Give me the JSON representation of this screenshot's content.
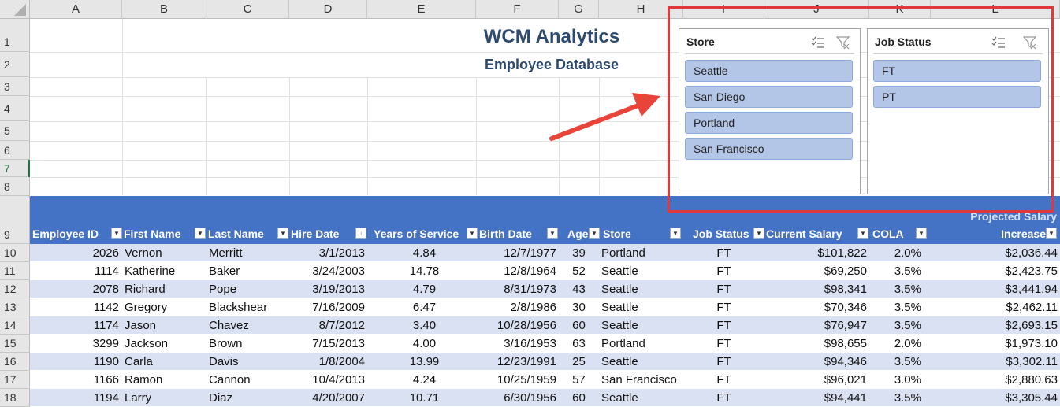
{
  "columns": [
    "A",
    "B",
    "C",
    "D",
    "E",
    "F",
    "G",
    "H",
    "I",
    "J",
    "K",
    "L"
  ],
  "row_numbers": [
    "1",
    "2",
    "3",
    "4",
    "5",
    "6",
    "7",
    "8",
    "9",
    "10",
    "11",
    "12",
    "13",
    "14",
    "15",
    "16",
    "17",
    "18"
  ],
  "title": "WCM Analytics",
  "subtitle": "Employee Database",
  "headers": {
    "employee_id": "Employee ID",
    "first_name": "First Name",
    "last_name": "Last Name",
    "hire_date": "Hire Date",
    "years_service": "Years of Service",
    "birth_date": "Birth Date",
    "age": "Age",
    "store": "Store",
    "job_status": "Job Status",
    "current_salary": "Current Salary",
    "cola": "COLA",
    "projected_line1": "Projected Salary",
    "projected_line2": "Increase"
  },
  "rows": [
    {
      "id": "2026",
      "first": "Vernon",
      "last": "Merritt",
      "hire": "3/1/2013",
      "years": "4.84",
      "birth": "12/7/1977",
      "age": "39",
      "store": "Portland",
      "status": "FT",
      "salary": "$101,822",
      "cola": "2.0%",
      "projected": "$2,036.44"
    },
    {
      "id": "1114",
      "first": "Katherine",
      "last": "Baker",
      "hire": "3/24/2003",
      "years": "14.78",
      "birth": "12/8/1964",
      "age": "52",
      "store": "Seattle",
      "status": "FT",
      "salary": "$69,250",
      "cola": "3.5%",
      "projected": "$2,423.75"
    },
    {
      "id": "2078",
      "first": "Richard",
      "last": "Pope",
      "hire": "3/19/2013",
      "years": "4.79",
      "birth": "8/31/1973",
      "age": "43",
      "store": "Seattle",
      "status": "FT",
      "salary": "$98,341",
      "cola": "3.5%",
      "projected": "$3,441.94"
    },
    {
      "id": "1142",
      "first": "Gregory",
      "last": "Blackshear",
      "hire": "7/16/2009",
      "years": "6.47",
      "birth": "2/8/1986",
      "age": "30",
      "store": "Seattle",
      "status": "FT",
      "salary": "$70,346",
      "cola": "3.5%",
      "projected": "$2,462.11"
    },
    {
      "id": "1174",
      "first": "Jason",
      "last": "Chavez",
      "hire": "8/7/2012",
      "years": "3.40",
      "birth": "10/28/1956",
      "age": "60",
      "store": "Seattle",
      "status": "FT",
      "salary": "$76,947",
      "cola": "3.5%",
      "projected": "$2,693.15"
    },
    {
      "id": "3299",
      "first": "Jackson",
      "last": "Brown",
      "hire": "7/15/2013",
      "years": "4.00",
      "birth": "3/16/1953",
      "age": "63",
      "store": "Portland",
      "status": "FT",
      "salary": "$98,655",
      "cola": "2.0%",
      "projected": "$1,973.10"
    },
    {
      "id": "1190",
      "first": "Carla",
      "last": "Davis",
      "hire": "1/8/2004",
      "years": "13.99",
      "birth": "12/23/1991",
      "age": "25",
      "store": "Seattle",
      "status": "FT",
      "salary": "$94,346",
      "cola": "3.5%",
      "projected": "$3,302.11"
    },
    {
      "id": "1166",
      "first": "Ramon",
      "last": "Cannon",
      "hire": "10/4/2013",
      "years": "4.24",
      "birth": "10/25/1959",
      "age": "57",
      "store": "San Francisco",
      "status": "FT",
      "salary": "$96,021",
      "cola": "3.0%",
      "projected": "$2,880.63"
    },
    {
      "id": "1194",
      "first": "Larry",
      "last": "Diaz",
      "hire": "4/20/2007",
      "years": "10.71",
      "birth": "6/30/1956",
      "age": "60",
      "store": "Seattle",
      "status": "FT",
      "salary": "$94,441",
      "cola": "3.5%",
      "projected": "$3,305.44"
    }
  ],
  "store_slicer": {
    "title": "Store",
    "items": [
      "Seattle",
      "San Diego",
      "Portland",
      "San Francisco"
    ]
  },
  "job_status_slicer": {
    "title": "Job Status",
    "items": [
      "FT",
      "PT"
    ]
  },
  "icons": {
    "multiselect": "multi-select-icon",
    "clear_filter": "clear-filter-icon",
    "filter_dropdown": "filter-dropdown-icon",
    "sort_filter": "sort-descending-filter-icon"
  },
  "colors": {
    "header_band": "#4472c4",
    "band_row": "#d9e1f2",
    "slicer_item": "#b4c6e7",
    "title": "#2e4a6e",
    "highlight_box": "#e0393b",
    "arrow": "#e8443a"
  }
}
